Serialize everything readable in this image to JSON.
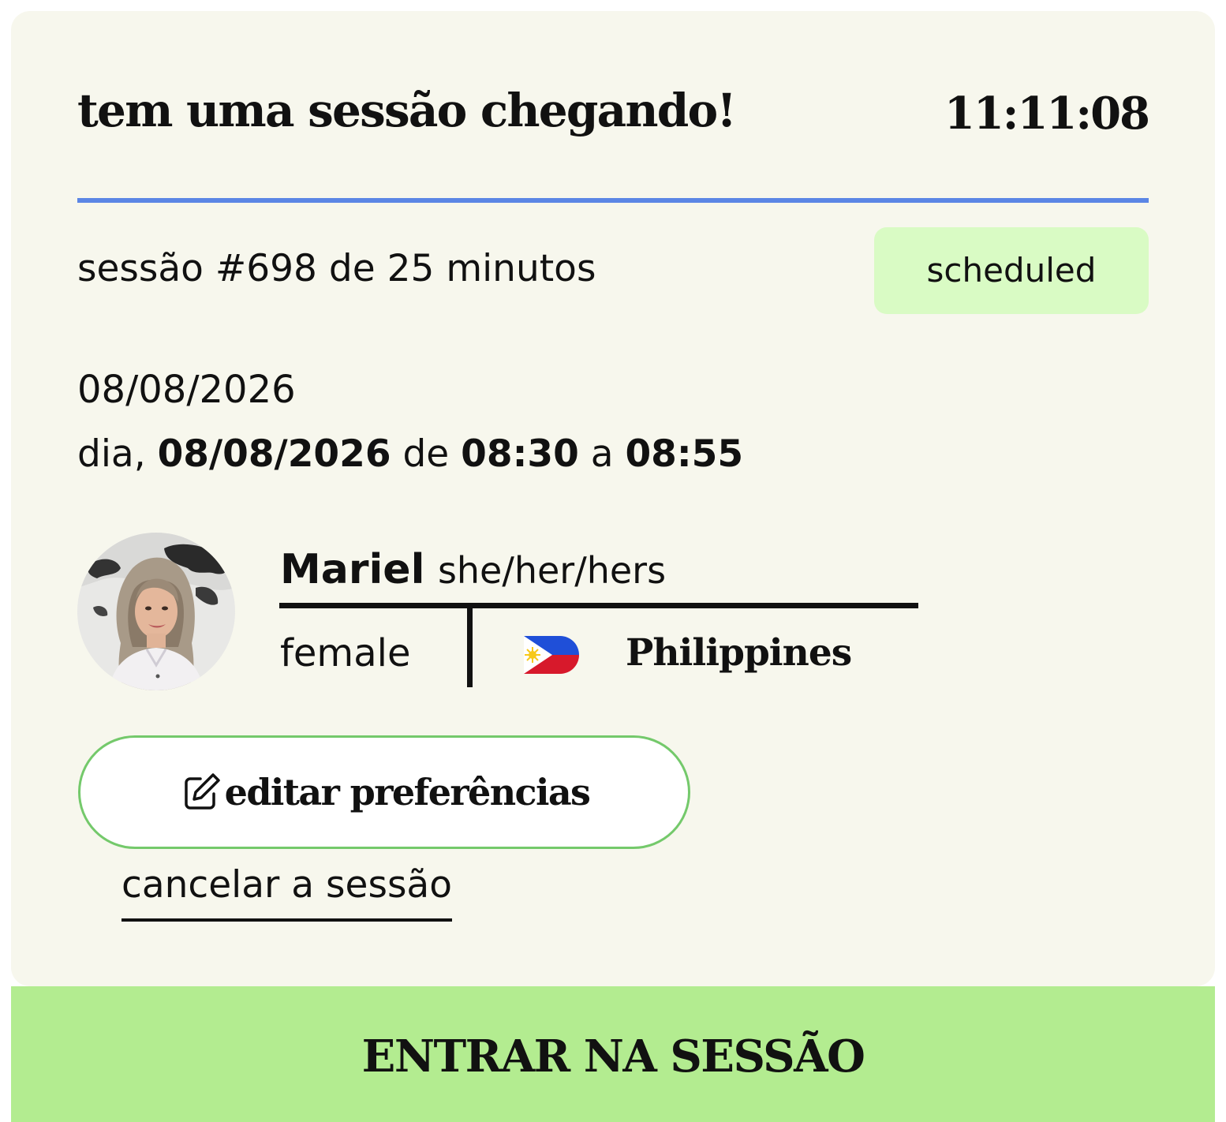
{
  "header": {
    "title": "tem uma sessão chegando!",
    "countdown": "11:11:08"
  },
  "progress": {
    "fraction": 1.0,
    "color": "#5b86e5"
  },
  "session": {
    "summary": "sessão #698 de 25 minutos",
    "status": "scheduled",
    "status_color": "#d9fbc4",
    "date": "08/08/2026",
    "schedule_prefix": "dia, ",
    "schedule_date": "08/08/2026",
    "schedule_from_word": " de ",
    "start_time": "08:30",
    "schedule_to_word": " a ",
    "end_time": "08:55"
  },
  "tutor": {
    "avatar_icon": "avatar-photo",
    "name": "Mariel",
    "pronouns": "she/her/hers",
    "gender": "female",
    "country_flag_icon": "philippines-flag-icon",
    "country": "Philippines"
  },
  "actions": {
    "edit_icon": "edit-icon",
    "edit_label": "editar preferências",
    "edit_border_color": "#74c96b",
    "cancel_label": "cancelar a sessão",
    "join_label": "ENTRAR NA SESSÃO",
    "join_color": "#b3ec90"
  }
}
